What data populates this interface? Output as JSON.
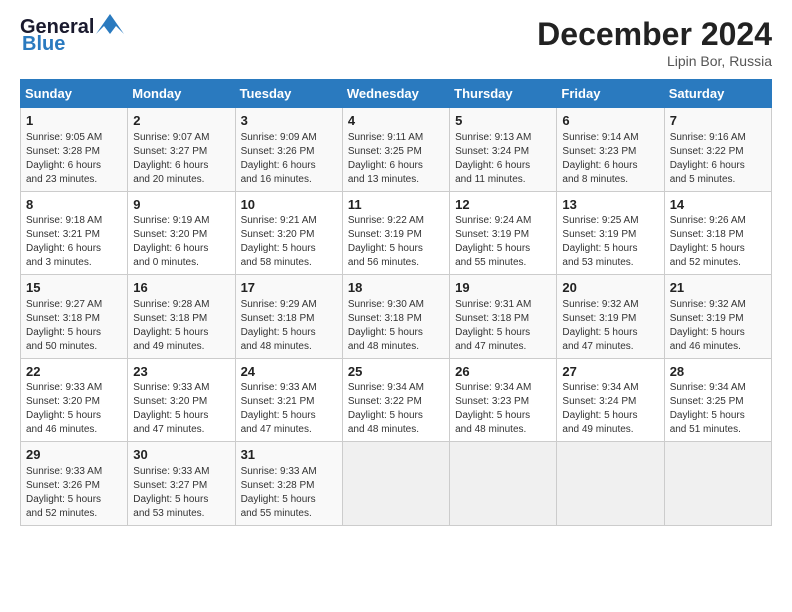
{
  "header": {
    "logo_line1": "General",
    "logo_line2": "Blue",
    "month": "December 2024",
    "location": "Lipin Bor, Russia"
  },
  "days_of_week": [
    "Sunday",
    "Monday",
    "Tuesday",
    "Wednesday",
    "Thursday",
    "Friday",
    "Saturday"
  ],
  "weeks": [
    [
      {
        "day": "1",
        "detail": "Sunrise: 9:05 AM\nSunset: 3:28 PM\nDaylight: 6 hours\nand 23 minutes."
      },
      {
        "day": "2",
        "detail": "Sunrise: 9:07 AM\nSunset: 3:27 PM\nDaylight: 6 hours\nand 20 minutes."
      },
      {
        "day": "3",
        "detail": "Sunrise: 9:09 AM\nSunset: 3:26 PM\nDaylight: 6 hours\nand 16 minutes."
      },
      {
        "day": "4",
        "detail": "Sunrise: 9:11 AM\nSunset: 3:25 PM\nDaylight: 6 hours\nand 13 minutes."
      },
      {
        "day": "5",
        "detail": "Sunrise: 9:13 AM\nSunset: 3:24 PM\nDaylight: 6 hours\nand 11 minutes."
      },
      {
        "day": "6",
        "detail": "Sunrise: 9:14 AM\nSunset: 3:23 PM\nDaylight: 6 hours\nand 8 minutes."
      },
      {
        "day": "7",
        "detail": "Sunrise: 9:16 AM\nSunset: 3:22 PM\nDaylight: 6 hours\nand 5 minutes."
      }
    ],
    [
      {
        "day": "8",
        "detail": "Sunrise: 9:18 AM\nSunset: 3:21 PM\nDaylight: 6 hours\nand 3 minutes."
      },
      {
        "day": "9",
        "detail": "Sunrise: 9:19 AM\nSunset: 3:20 PM\nDaylight: 6 hours\nand 0 minutes."
      },
      {
        "day": "10",
        "detail": "Sunrise: 9:21 AM\nSunset: 3:20 PM\nDaylight: 5 hours\nand 58 minutes."
      },
      {
        "day": "11",
        "detail": "Sunrise: 9:22 AM\nSunset: 3:19 PM\nDaylight: 5 hours\nand 56 minutes."
      },
      {
        "day": "12",
        "detail": "Sunrise: 9:24 AM\nSunset: 3:19 PM\nDaylight: 5 hours\nand 55 minutes."
      },
      {
        "day": "13",
        "detail": "Sunrise: 9:25 AM\nSunset: 3:19 PM\nDaylight: 5 hours\nand 53 minutes."
      },
      {
        "day": "14",
        "detail": "Sunrise: 9:26 AM\nSunset: 3:18 PM\nDaylight: 5 hours\nand 52 minutes."
      }
    ],
    [
      {
        "day": "15",
        "detail": "Sunrise: 9:27 AM\nSunset: 3:18 PM\nDaylight: 5 hours\nand 50 minutes."
      },
      {
        "day": "16",
        "detail": "Sunrise: 9:28 AM\nSunset: 3:18 PM\nDaylight: 5 hours\nand 49 minutes."
      },
      {
        "day": "17",
        "detail": "Sunrise: 9:29 AM\nSunset: 3:18 PM\nDaylight: 5 hours\nand 48 minutes."
      },
      {
        "day": "18",
        "detail": "Sunrise: 9:30 AM\nSunset: 3:18 PM\nDaylight: 5 hours\nand 48 minutes."
      },
      {
        "day": "19",
        "detail": "Sunrise: 9:31 AM\nSunset: 3:18 PM\nDaylight: 5 hours\nand 47 minutes."
      },
      {
        "day": "20",
        "detail": "Sunrise: 9:32 AM\nSunset: 3:19 PM\nDaylight: 5 hours\nand 47 minutes."
      },
      {
        "day": "21",
        "detail": "Sunrise: 9:32 AM\nSunset: 3:19 PM\nDaylight: 5 hours\nand 46 minutes."
      }
    ],
    [
      {
        "day": "22",
        "detail": "Sunrise: 9:33 AM\nSunset: 3:20 PM\nDaylight: 5 hours\nand 46 minutes."
      },
      {
        "day": "23",
        "detail": "Sunrise: 9:33 AM\nSunset: 3:20 PM\nDaylight: 5 hours\nand 47 minutes."
      },
      {
        "day": "24",
        "detail": "Sunrise: 9:33 AM\nSunset: 3:21 PM\nDaylight: 5 hours\nand 47 minutes."
      },
      {
        "day": "25",
        "detail": "Sunrise: 9:34 AM\nSunset: 3:22 PM\nDaylight: 5 hours\nand 48 minutes."
      },
      {
        "day": "26",
        "detail": "Sunrise: 9:34 AM\nSunset: 3:23 PM\nDaylight: 5 hours\nand 48 minutes."
      },
      {
        "day": "27",
        "detail": "Sunrise: 9:34 AM\nSunset: 3:24 PM\nDaylight: 5 hours\nand 49 minutes."
      },
      {
        "day": "28",
        "detail": "Sunrise: 9:34 AM\nSunset: 3:25 PM\nDaylight: 5 hours\nand 51 minutes."
      }
    ],
    [
      {
        "day": "29",
        "detail": "Sunrise: 9:33 AM\nSunset: 3:26 PM\nDaylight: 5 hours\nand 52 minutes."
      },
      {
        "day": "30",
        "detail": "Sunrise: 9:33 AM\nSunset: 3:27 PM\nDaylight: 5 hours\nand 53 minutes."
      },
      {
        "day": "31",
        "detail": "Sunrise: 9:33 AM\nSunset: 3:28 PM\nDaylight: 5 hours\nand 55 minutes."
      },
      {
        "day": "",
        "detail": ""
      },
      {
        "day": "",
        "detail": ""
      },
      {
        "day": "",
        "detail": ""
      },
      {
        "day": "",
        "detail": ""
      }
    ]
  ]
}
